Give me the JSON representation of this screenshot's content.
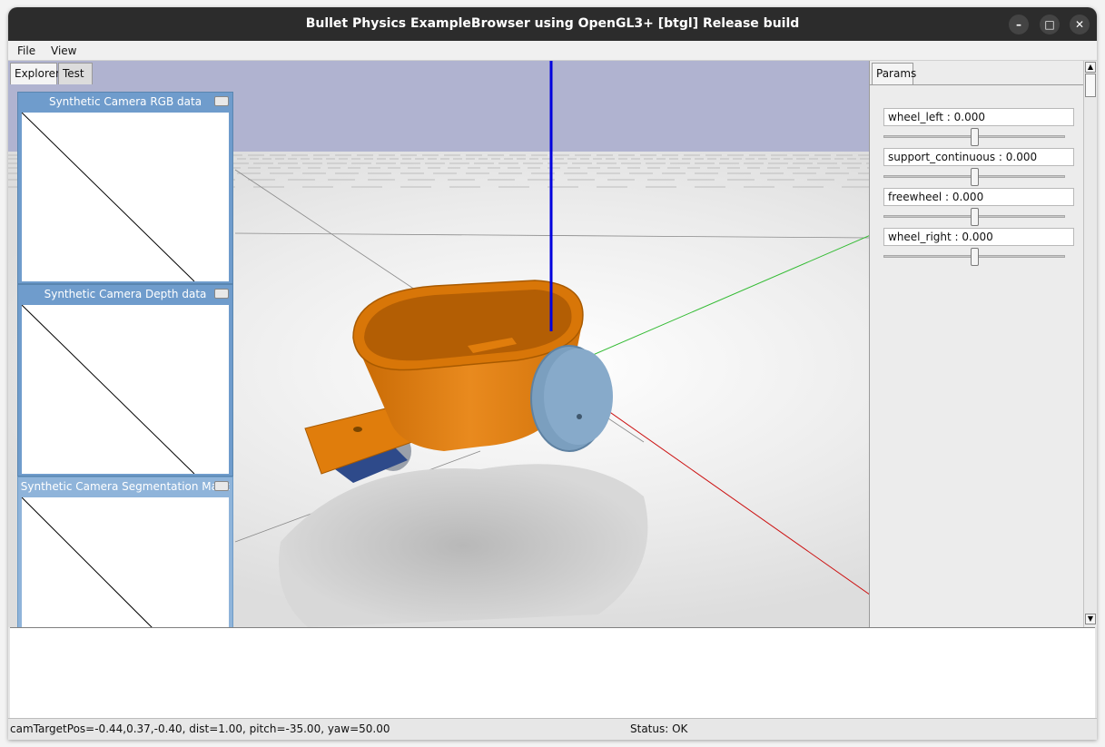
{
  "window": {
    "title": "Bullet Physics ExampleBrowser using OpenGL3+ [btgl] Release build",
    "controls": {
      "minimize": "–",
      "maximize": "□",
      "close": "✕"
    }
  },
  "menu": {
    "file": "File",
    "view": "View"
  },
  "left_tabs": {
    "explorer": "Explorer",
    "test": "Test"
  },
  "camera_windows": [
    {
      "title": "Synthetic Camera RGB data"
    },
    {
      "title": "Synthetic Camera Depth data"
    },
    {
      "title": "Synthetic Camera Segmentation Mask"
    }
  ],
  "params": {
    "tab": "Params",
    "items": [
      {
        "label": "wheel_left : 0.000",
        "value": 0.5
      },
      {
        "label": "support_continuous : 0.000",
        "value": 0.5
      },
      {
        "label": "freewheel : 0.000",
        "value": 0.5
      },
      {
        "label": "wheel_right : 0.000",
        "value": 0.5
      }
    ]
  },
  "status": {
    "camera": "camTargetPos=-0.44,0.37,-0.40, dist=1.00, pitch=-35.00, yaw=50.00",
    "state": "Status: OK"
  },
  "colors": {
    "sky": "#b0b3d0",
    "floor": "#e8e8e8",
    "axis_x": "#cc1111",
    "axis_y": "#33bb33",
    "axis_z": "#0000dd",
    "robot_body": "#e07d0c",
    "wheel": "#7b9fbf",
    "caster": "#2e4a8a",
    "titlebar": "#2c2c2c"
  }
}
